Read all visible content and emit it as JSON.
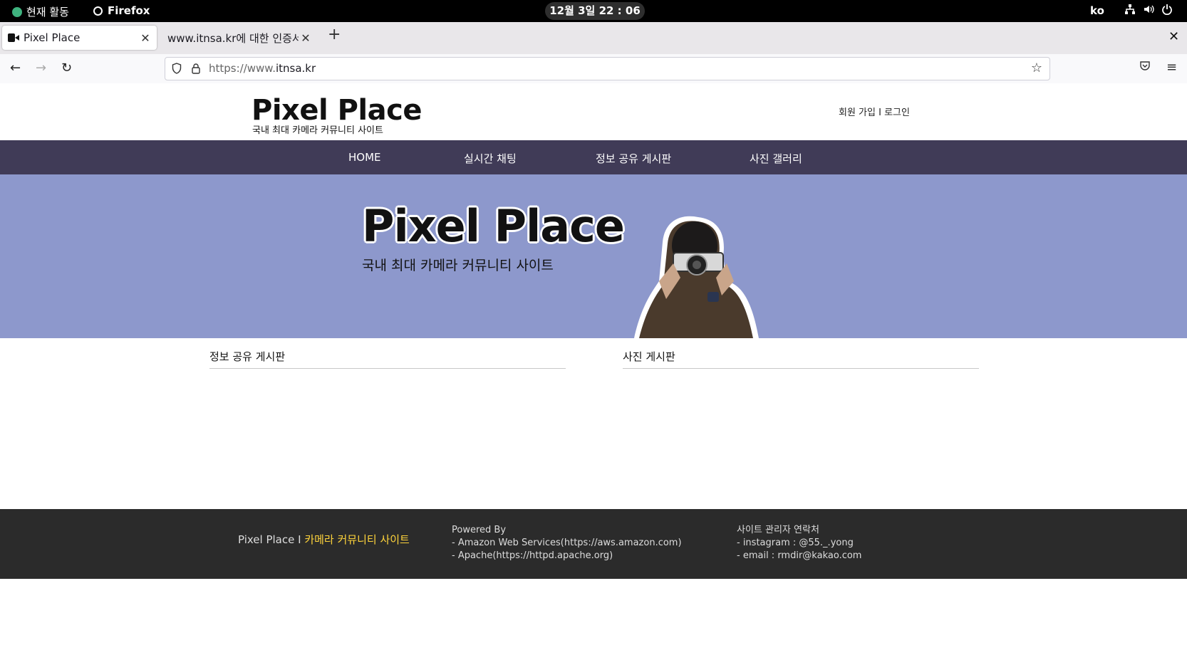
{
  "system": {
    "activities": "현재 활동",
    "app": "Firefox",
    "clock": "12월 3일  22 : 06",
    "lang": "ko"
  },
  "browser": {
    "tabs": [
      {
        "title": "Pixel Place",
        "active": true
      },
      {
        "title": "www.itnsa.kr에 대한 인증서",
        "active": false
      }
    ],
    "url_prefix": "https://www.",
    "url_domain": "itnsa.kr"
  },
  "site": {
    "logo": "Pixel Place",
    "logo_sub": "국내 최대 카메라 커뮤니티 사이트",
    "auth": "회원 가입 I 로그인",
    "nav": [
      "HOME",
      "실시간 채팅",
      "정보 공유 게시판",
      "사진 갤러리"
    ],
    "banner_title": "Pixel Place",
    "banner_sub": "국내 최대 카메라 커뮤니티 사이트",
    "sections": [
      "정보 공유 게시판",
      "사진 게시판"
    ],
    "footer": {
      "brand": "Pixel Place I ",
      "brand_accent": "카메라 커뮤니티 사이트",
      "powered_title": "Powered By",
      "powered_lines": [
        "- Amazon Web Services(https://aws.amazon.com)",
        "- Apache(https://httpd.apache.org)"
      ],
      "contact_title": "사이트 관리자 연락처",
      "contact_lines": [
        "- instagram : @55._.yong",
        "- email : rmdir@kakao.com"
      ]
    }
  },
  "colors": {
    "nav_bg": "#403b57",
    "banner_bg": "#8d98cc",
    "footer_bg": "#2b2b2b",
    "accent": "#ffd43b"
  }
}
